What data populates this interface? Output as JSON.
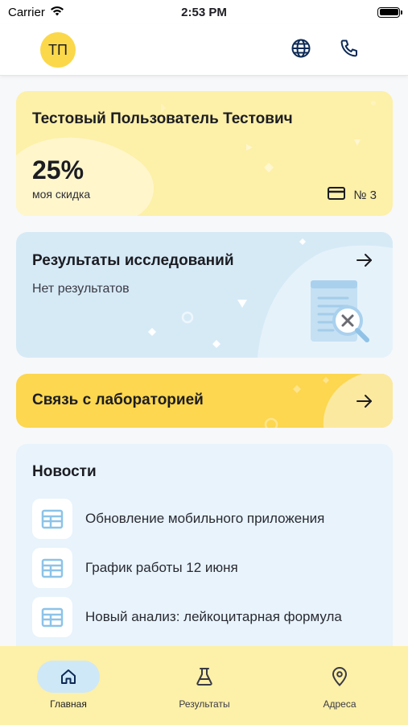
{
  "status_bar": {
    "carrier": "Carrier",
    "time": "2:53 PM"
  },
  "header": {
    "avatar_initials": "ТП",
    "icons": [
      "globe-icon",
      "phone-icon"
    ]
  },
  "discount_card": {
    "user_name": "Тестовый Пользователь Тестович",
    "discount_value": "25%",
    "discount_label": "моя скидка",
    "card_number": "№ 3",
    "icons": [
      "credit-card-icon"
    ]
  },
  "research_card": {
    "title": "Результаты исследований",
    "subtitle": "Нет результатов",
    "icons": [
      "arrow-right-icon",
      "document-search-icon"
    ]
  },
  "contact_card": {
    "title": "Связь с лабораторией",
    "icons": [
      "arrow-right-icon"
    ]
  },
  "news": {
    "title": "Новости",
    "items": [
      {
        "text": "Обновление мобильного приложения",
        "icon": "calendar-icon"
      },
      {
        "text": "График работы 12 июня",
        "icon": "calendar-icon"
      },
      {
        "text": "Новый анализ: лейкоцитарная формула",
        "icon": "calendar-icon"
      }
    ]
  },
  "tabbar": {
    "tabs": [
      {
        "label": "Главная",
        "icon": "home-icon",
        "active": true
      },
      {
        "label": "Результаты",
        "icon": "flask-icon",
        "active": false
      },
      {
        "label": "Адреса",
        "icon": "map-pin-icon",
        "active": false
      }
    ]
  },
  "colors": {
    "accent_yellow": "#fcd74f",
    "light_yellow": "#fdf0a8",
    "light_blue": "#d6eaf6",
    "news_bg": "#e8f3fb",
    "active_tab_pill": "#cfe8f7",
    "icon_dark": "#0d2a56"
  }
}
